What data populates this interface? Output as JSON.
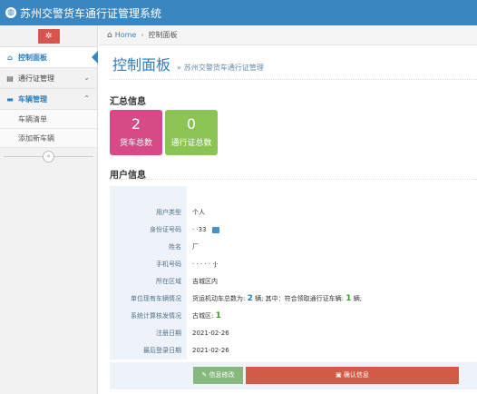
{
  "header": {
    "title": "苏州交警货车通行证管理系统",
    "logo_icon": "globe-icon"
  },
  "sidebar": {
    "items": [
      {
        "label": "控制面板",
        "icon": "home-icon"
      },
      {
        "label": "通行证管理",
        "icon": "book-icon"
      },
      {
        "label": "车辆管理",
        "icon": "car-icon"
      }
    ],
    "subitems": [
      {
        "label": "车辆清单"
      },
      {
        "label": "添加新车辆"
      }
    ]
  },
  "breadcrumb": {
    "home": "Home",
    "current": "控制面板"
  },
  "page": {
    "title": "控制面板",
    "subtitle": "苏州交警货车通行证管理"
  },
  "summary": {
    "title": "汇总信息",
    "stats": [
      {
        "value": "2",
        "label": "货车总数",
        "color": "#d64b85"
      },
      {
        "value": "0",
        "label": "通行证总数",
        "color": "#8cc453"
      }
    ]
  },
  "user": {
    "title": "用户信息",
    "rows": [
      {
        "key": "用户类型",
        "value": "个人"
      },
      {
        "key": "身份证号码",
        "value": "·                    ·33"
      },
      {
        "key": "姓名",
        "value": "厂"
      },
      {
        "key": "手机号码",
        "value": "·  ·  ·  ·  ·  ·J·"
      },
      {
        "key": "所在区域",
        "value": "吉城区内"
      },
      {
        "key": "单位现有车辆情况",
        "value_prefix": "货运机动车总数为:",
        "value_num1": "2",
        "value_mid": "辆; 其中：符合领取通行证车辆:",
        "value_num2": "1",
        "value_suffix": "辆;"
      },
      {
        "key": "系统计算核发情况",
        "value_prefix": "古城区:",
        "value_num": "1"
      },
      {
        "key": "注册日期",
        "value": "2021-02-26"
      },
      {
        "key": "最后登录日期",
        "value": "2021-02-26"
      }
    ]
  },
  "buttons": {
    "edit": "信息修改",
    "confirm": "确认信息"
  }
}
